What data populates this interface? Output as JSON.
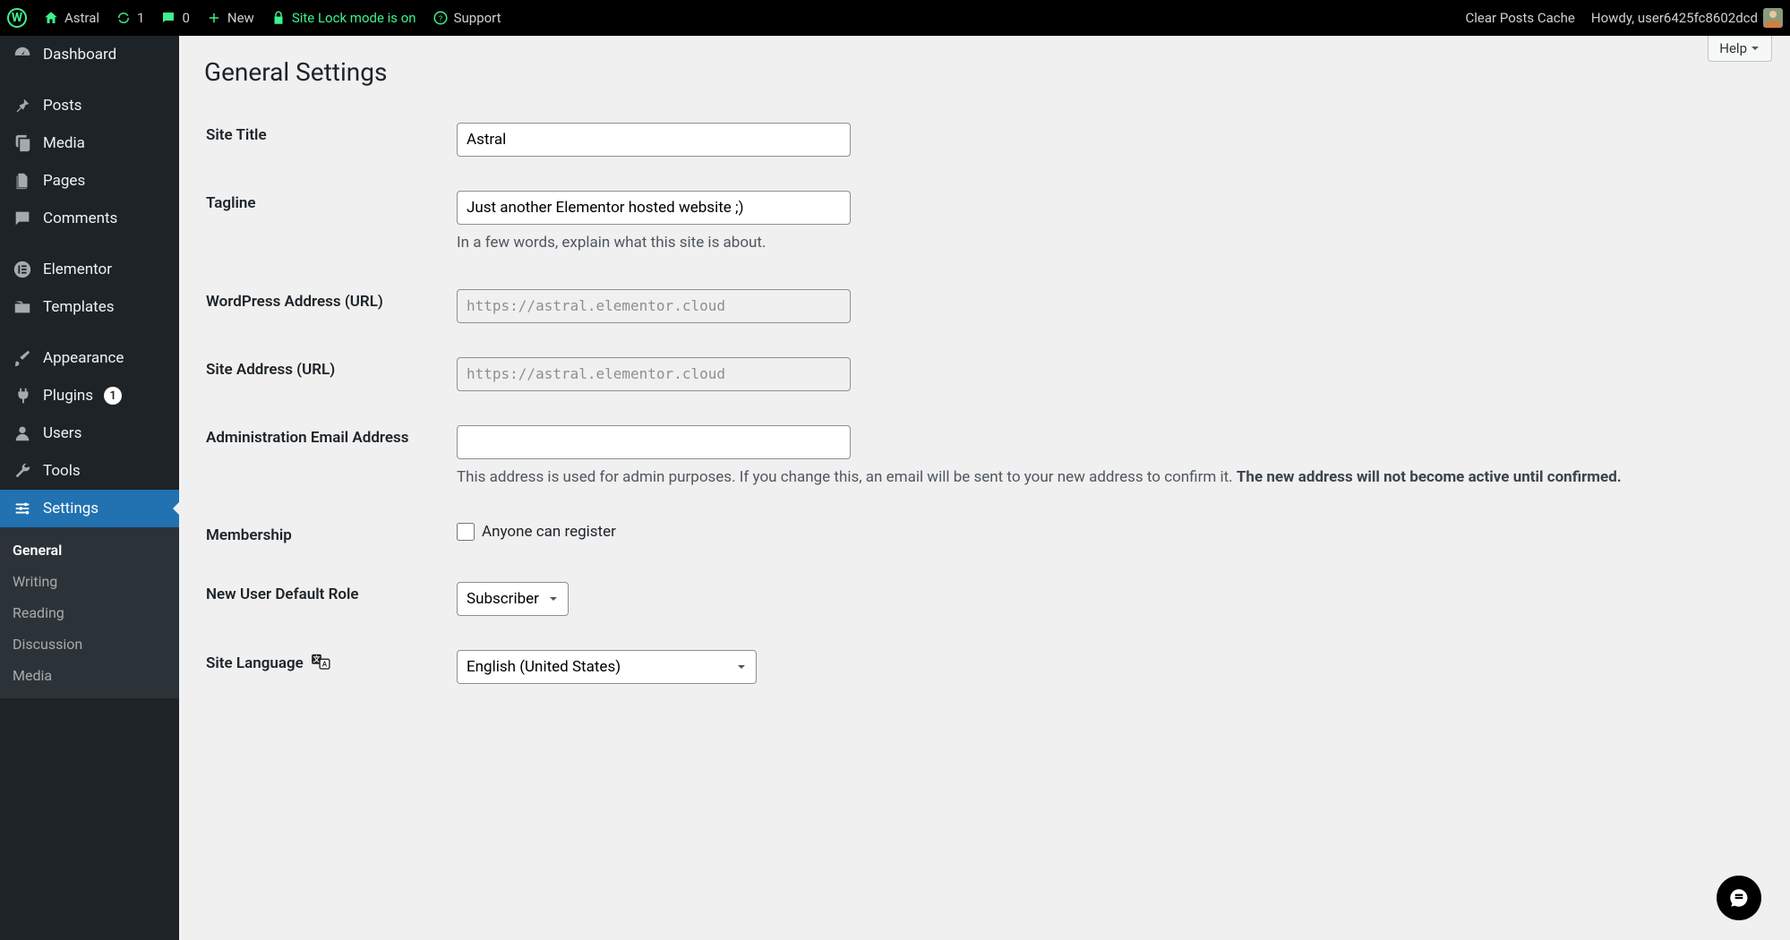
{
  "adminbar": {
    "site_name": "Astral",
    "update_count": "1",
    "comment_count": "0",
    "new_label": "New",
    "site_lock": "Site Lock mode is on",
    "support": "Support",
    "clear_cache": "Clear Posts Cache",
    "howdy": "Howdy, user6425fc8602dcd"
  },
  "sidebar": {
    "dashboard": "Dashboard",
    "posts": "Posts",
    "media": "Media",
    "pages": "Pages",
    "comments": "Comments",
    "elementor": "Elementor",
    "templates": "Templates",
    "appearance": "Appearance",
    "plugins": "Plugins",
    "plugins_badge": "1",
    "users": "Users",
    "tools": "Tools",
    "settings": "Settings",
    "sub": {
      "general": "General",
      "writing": "Writing",
      "reading": "Reading",
      "discussion": "Discussion",
      "media": "Media"
    }
  },
  "page": {
    "title": "General Settings",
    "help": "Help"
  },
  "fields": {
    "site_title": {
      "label": "Site Title",
      "value": "Astral"
    },
    "tagline": {
      "label": "Tagline",
      "value": "Just another Elementor hosted website ;)",
      "desc": "In a few words, explain what this site is about."
    },
    "wp_url": {
      "label": "WordPress Address (URL)",
      "value": "https://astral.elementor.cloud"
    },
    "site_url": {
      "label": "Site Address (URL)",
      "value": "https://astral.elementor.cloud"
    },
    "admin_email": {
      "label": "Administration Email Address",
      "value": "",
      "desc1": "This address is used for admin purposes. If you change this, an email will be sent to your new address to confirm it. ",
      "desc2": "The new address will not become active until confirmed."
    },
    "membership": {
      "label": "Membership",
      "option": "Anyone can register"
    },
    "default_role": {
      "label": "New User Default Role",
      "value": "Subscriber"
    },
    "site_language": {
      "label": "Site Language",
      "value": "English (United States)"
    }
  }
}
